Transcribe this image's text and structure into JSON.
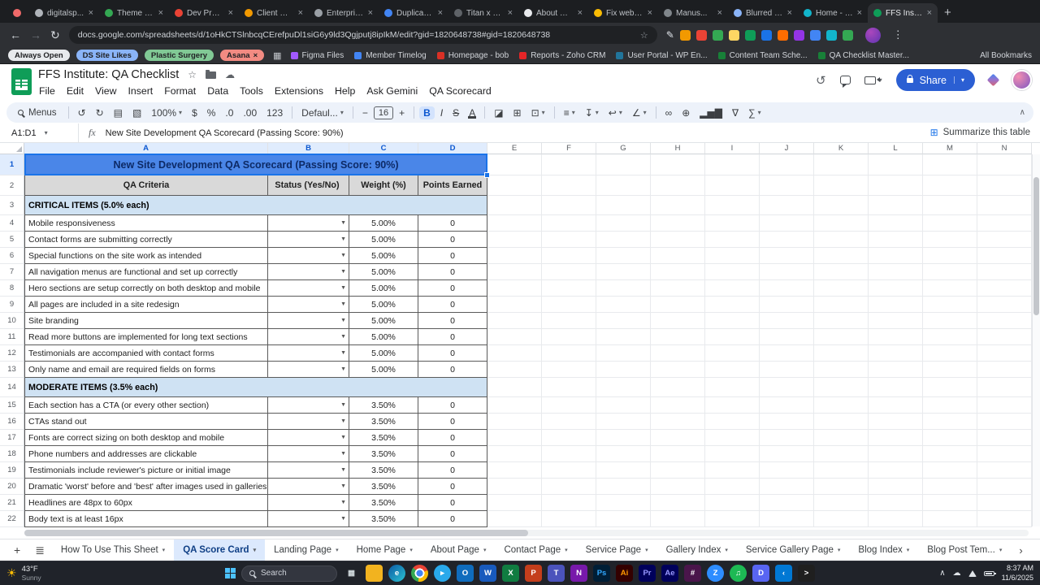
{
  "browser": {
    "tab_strip": {
      "new_tab_label": "+",
      "tabs": [
        {
          "label": "",
          "name": "asana",
          "favicon_color": "#f06a6a",
          "pinned": true
        },
        {
          "label": "digitalsp...",
          "favicon_color": "#b0b4ba"
        },
        {
          "label": "Theme B...",
          "favicon_color": "#34a853"
        },
        {
          "label": "Dev Proj...",
          "favicon_color": "#ea4335"
        },
        {
          "label": "Client Onb...",
          "favicon_color": "#f29900"
        },
        {
          "label": "Enterpris...",
          "favicon_color": "#9aa0a6"
        },
        {
          "label": "Duplicate...",
          "favicon_color": "#4285f4"
        },
        {
          "label": "Titan x Di...",
          "favicon_color": "#5f6368"
        },
        {
          "label": "About Us...",
          "favicon_color": "#e8eaed"
        },
        {
          "label": "Fix webho...",
          "favicon_color": "#fbbc04"
        },
        {
          "label": "Manus...",
          "favicon_color": "#80868b"
        },
        {
          "label": "Blurred e...",
          "favicon_color": "#8ab4f8"
        },
        {
          "label": "Home - W...",
          "favicon_color": "#12b5cb"
        },
        {
          "label": "FFS Institu...",
          "favicon_color": "#0f9d58",
          "active": true
        }
      ]
    },
    "address_bar": {
      "url": "docs.google.com/spreadsheets/d/1oHkCTSlnbcqCErefpuDl1siG6y9ld3Qgjputj8ipIkM/edit?gid=1820648738#gid=1820648738"
    },
    "extensions": [
      {
        "name": "edit-extension-icon",
        "glyph": "✎"
      },
      {
        "name": "extension-1-icon",
        "color": "#f29900"
      },
      {
        "name": "extension-2-icon",
        "color": "#ea4335"
      },
      {
        "name": "extension-3-icon",
        "color": "#34a853"
      },
      {
        "name": "extension-4-icon",
        "color": "#fdd663"
      },
      {
        "name": "extension-5-icon",
        "color": "#0f9d58"
      },
      {
        "name": "extension-6-icon",
        "color": "#1a73e8"
      },
      {
        "name": "extension-7-icon",
        "color": "#ff6d01"
      },
      {
        "name": "extension-8-icon",
        "color": "#9334e6"
      },
      {
        "name": "extension-9-icon",
        "color": "#4285f4"
      },
      {
        "name": "extension-10-icon",
        "color": "#12b5cb"
      },
      {
        "name": "extension-11-icon",
        "color": "#34a853"
      }
    ],
    "bookmarks_bar": {
      "tab_groups": [
        {
          "label": "Always Open",
          "color": "#e8eaed"
        },
        {
          "label": "DS Site Likes",
          "color": "#8ab4f8"
        },
        {
          "label": "Plastic Surgery",
          "color": "#81c995"
        },
        {
          "label": "Asana",
          "color": "#f28b82",
          "close": true
        }
      ],
      "bookmarks": [
        {
          "label": "Figma Files",
          "color": "#a259ff"
        },
        {
          "label": "Member Timelog",
          "color": "#4285f4"
        },
        {
          "label": "Homepage - bob",
          "color": "#d93025"
        },
        {
          "label": "Reports - Zoho CRM",
          "color": "#e42527"
        },
        {
          "label": "User Portal - WP En...",
          "color": "#21759b"
        },
        {
          "label": "Content Team Sche...",
          "color": "#188038"
        },
        {
          "label": "QA Checklist Master...",
          "color": "#188038"
        }
      ],
      "all_bookmarks_label": "All Bookmarks"
    }
  },
  "sheets": {
    "doc_title": "FFS Institute: QA Checklist",
    "menu_items": [
      "File",
      "Edit",
      "View",
      "Insert",
      "Format",
      "Data",
      "Tools",
      "Extensions",
      "Help",
      "Ask Gemini",
      "QA Scorecard"
    ],
    "share_label": "Share",
    "toolbar": {
      "menus_label": "Menus",
      "items": [
        {
          "name": "undo-icon",
          "glyph": "↺"
        },
        {
          "name": "redo-icon",
          "glyph": "↻"
        },
        {
          "name": "print-icon",
          "glyph": "▤"
        },
        {
          "name": "paint-format-icon",
          "glyph": "▧"
        },
        {
          "name": "zoom-select",
          "label": "100%",
          "caret": true
        },
        {
          "name": "currency-format-icon",
          "glyph": "$"
        },
        {
          "name": "percent-format-icon",
          "glyph": "%"
        },
        {
          "name": "decrease-decimal-icon",
          "glyph": ".0"
        },
        {
          "name": "increase-decimal-icon",
          "glyph": ".00"
        },
        {
          "name": "number-format-icon",
          "glyph": "123"
        },
        {
          "name": "sep"
        },
        {
          "name": "font-family-select",
          "label": "Defaul...",
          "caret": true
        },
        {
          "name": "sep"
        },
        {
          "name": "decrease-font-size-icon",
          "glyph": "−"
        },
        {
          "name": "font-size-input",
          "label": "16",
          "boxed": true
        },
        {
          "name": "increase-font-size-icon",
          "glyph": "+"
        },
        {
          "name": "sep"
        },
        {
          "name": "bold-icon",
          "glyph": "B",
          "bold": true,
          "active": true
        },
        {
          "name": "italic-icon",
          "glyph": "I",
          "italic": true
        },
        {
          "name": "strikethrough-icon",
          "glyph": "S",
          "strike": true
        },
        {
          "name": "text-color-icon",
          "glyph": "A",
          "underbar": true
        },
        {
          "name": "sep"
        },
        {
          "name": "fill-color-icon",
          "glyph": "◪"
        },
        {
          "name": "borders-icon",
          "glyph": "⊞"
        },
        {
          "name": "merge-cells-icon",
          "glyph": "⊡",
          "caret": true
        },
        {
          "name": "sep"
        },
        {
          "name": "horizontal-align-icon",
          "glyph": "≡",
          "caret": true
        },
        {
          "name": "vertical-align-icon",
          "glyph": "↧",
          "caret": true
        },
        {
          "name": "text-wrap-icon",
          "glyph": "↩",
          "caret": true
        },
        {
          "name": "text-rotate-icon",
          "glyph": "∠",
          "caret": true
        },
        {
          "name": "sep"
        },
        {
          "name": "insert-link-icon",
          "glyph": "∞"
        },
        {
          "name": "insert-comment-icon",
          "glyph": "⊕"
        },
        {
          "name": "insert-chart-icon",
          "glyph": "▂▅▇"
        },
        {
          "name": "create-filter-icon",
          "glyph": "∇"
        },
        {
          "name": "functions-icon",
          "glyph": "∑",
          "caret": true
        }
      ]
    },
    "formula_bar": {
      "name_box": "A1:D1",
      "fx_label": "fx",
      "content": "New Site Development QA Scorecard (Passing Score: 90%)"
    },
    "summarize_button": "Summarize this table",
    "grid": {
      "column_letters": [
        "A",
        "B",
        "C",
        "D",
        "E",
        "F",
        "G",
        "H",
        "I",
        "J",
        "K",
        "L",
        "M",
        "N"
      ],
      "selected_columns": [
        "A",
        "B",
        "C",
        "D"
      ],
      "table": {
        "title": "New Site Development QA Scorecard (Passing Score: 90%)",
        "headers": [
          "QA Criteria",
          "Status (Yes/No)",
          "Weight (%)",
          "Points Earned"
        ],
        "sections": [
          {
            "label": "CRITICAL ITEMS (5.0% each)",
            "items": [
              {
                "criteria": "Mobile responsiveness",
                "status": "",
                "weight": "5.00%",
                "points": "0"
              },
              {
                "criteria": "Contact forms are submitting correctly",
                "status": "",
                "weight": "5.00%",
                "points": "0"
              },
              {
                "criteria": "Special functions on the site work as intended",
                "status": "",
                "weight": "5.00%",
                "points": "0"
              },
              {
                "criteria": "All navigation menus are functional and set up correctly",
                "status": "",
                "weight": "5.00%",
                "points": "0"
              },
              {
                "criteria": "Hero sections are setup correctly on both desktop and mobile",
                "status": "",
                "weight": "5.00%",
                "points": "0"
              },
              {
                "criteria": "All pages are included in a site redesign",
                "status": "",
                "weight": "5.00%",
                "points": "0"
              },
              {
                "criteria": "Site branding",
                "status": "",
                "weight": "5.00%",
                "points": "0"
              },
              {
                "criteria": "Read more buttons are implemented for long text sections",
                "status": "",
                "weight": "5.00%",
                "points": "0"
              },
              {
                "criteria": "Testimonials are accompanied with contact forms",
                "status": "",
                "weight": "5.00%",
                "points": "0"
              },
              {
                "criteria": "Only name and email are required fields on forms",
                "status": "",
                "weight": "5.00%",
                "points": "0"
              }
            ]
          },
          {
            "label": "MODERATE ITEMS (3.5% each)",
            "items": [
              {
                "criteria": "Each section has a CTA (or every other section)",
                "status": "",
                "weight": "3.50%",
                "points": "0"
              },
              {
                "criteria": "CTAs stand out",
                "status": "",
                "weight": "3.50%",
                "points": "0"
              },
              {
                "criteria": "Fonts are correct sizing on both desktop and mobile",
                "status": "",
                "weight": "3.50%",
                "points": "0"
              },
              {
                "criteria": "Phone numbers and addresses are clickable",
                "status": "",
                "weight": "3.50%",
                "points": "0"
              },
              {
                "criteria": "Testimonials include reviewer's picture or initial image",
                "status": "",
                "weight": "3.50%",
                "points": "0"
              },
              {
                "criteria": "Dramatic 'worst' before and 'best' after images used in galleries",
                "status": "",
                "weight": "3.50%",
                "points": "0"
              },
              {
                "criteria": "Headlines are 48px to 60px",
                "status": "",
                "weight": "3.50%",
                "points": "0"
              },
              {
                "criteria": "Body text is at least 16px",
                "status": "",
                "weight": "3.50%",
                "points": "0"
              }
            ]
          }
        ]
      }
    },
    "sheet_tabs": [
      "How To Use This Sheet",
      "QA Score Card",
      "Landing Page",
      "Home Page",
      "About Page",
      "Contact Page",
      "Service Page",
      "Gallery Index",
      "Service Gallery Page",
      "Blog Index",
      "Blog Post Tem..."
    ],
    "active_sheet_tab": "QA Score Card"
  },
  "taskbar": {
    "weather": {
      "temperature": "43°F",
      "condition": "Sunny"
    },
    "search_label": "Search",
    "apps": [
      {
        "name": "task-view-icon",
        "glyph": "▦",
        "fg": "#cfd8dc"
      },
      {
        "name": "file-explorer-icon",
        "bg": "#f2b31f",
        "glyph": ""
      },
      {
        "name": "edge-icon",
        "bg": "linear-gradient(135deg,#0c59a4,#2bc3d2)",
        "glyph": "e",
        "round": true
      },
      {
        "name": "chrome-icon",
        "chrome": true
      },
      {
        "name": "telegram-icon",
        "bg": "#29a9eb",
        "glyph": "▸",
        "round": true
      },
      {
        "name": "outlook-icon",
        "bg": "#0f6cbd",
        "glyph": "O"
      },
      {
        "name": "word-icon",
        "bg": "#185abd",
        "glyph": "W"
      },
      {
        "name": "excel-icon",
        "bg": "#107c41",
        "glyph": "X"
      },
      {
        "name": "powerpoint-icon",
        "bg": "#c43e1c",
        "glyph": "P"
      },
      {
        "name": "teams-icon",
        "bg": "#4b53bc",
        "glyph": "T"
      },
      {
        "name": "onenote-icon",
        "bg": "#7719aa",
        "glyph": "N"
      },
      {
        "name": "photoshop-icon",
        "bg": "#001e36",
        "glyph": "Ps",
        "fg": "#31a8ff"
      },
      {
        "name": "illustrator-icon",
        "bg": "#330000",
        "glyph": "Ai",
        "fg": "#ff9a00"
      },
      {
        "name": "premiere-icon",
        "bg": "#00005b",
        "glyph": "Pr",
        "fg": "#9999ff"
      },
      {
        "name": "after-effects-icon",
        "bg": "#00005b",
        "glyph": "Ae",
        "fg": "#9999ff"
      },
      {
        "name": "slack-icon",
        "bg": "#4a154b",
        "glyph": "#"
      },
      {
        "name": "zoom-icon",
        "bg": "#2d8cff",
        "glyph": "Z",
        "round": true
      },
      {
        "name": "spotify-icon",
        "bg": "#1db954",
        "glyph": "♫",
        "round": true
      },
      {
        "name": "discord-icon",
        "bg": "#5865f2",
        "glyph": "D"
      },
      {
        "name": "vscode-icon",
        "bg": "#0078d4",
        "glyph": "‹"
      },
      {
        "name": "terminal-icon",
        "bg": "#1f1f1f",
        "glyph": ">"
      }
    ],
    "tray": {
      "time": "8:37 AM",
      "date": "11/6/2025"
    }
  }
}
